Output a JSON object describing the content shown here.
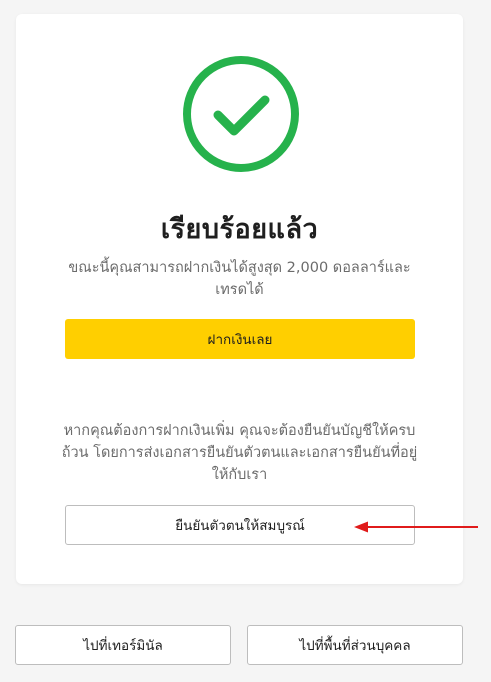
{
  "success": {
    "title": "เรียบร้อยแล้ว",
    "message": "ขณะนี้คุณสามารถฝากเงินได้สูงสุด 2,000 ดอลลาร์และเทรดได้",
    "deposit_button": "ฝากเงินเลย",
    "info_text": "หากคุณต้องการฝากเงินเพิ่ม คุณจะต้องยืนยันบัญชีให้ครบถ้วน โดยการส่งเอกสารยืนยันตัวตนและเอกสารยืนยันที่อยู่ให้กับเรา",
    "verify_button": "ยืนยันตัวตนให้สมบูรณ์",
    "icon": "check-circle-icon"
  },
  "footer": {
    "terminal_button": "ไปที่เทอร์มินัล",
    "personal_area_button": "ไปที่พื้นที่ส่วนบุคคล"
  },
  "colors": {
    "success_green": "#26b24c",
    "primary_yellow": "#ffcf00",
    "annotation_red": "#e01b1b"
  }
}
